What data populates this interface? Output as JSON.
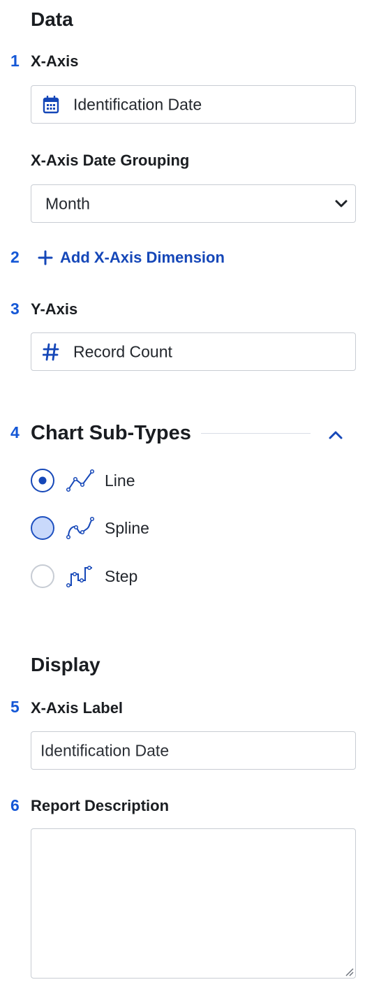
{
  "data_section": {
    "title": "Data",
    "x_axis": {
      "step": "1",
      "label": "X-Axis",
      "value": "Identification Date",
      "icon": "calendar-icon"
    },
    "date_grouping": {
      "label": "X-Axis Date Grouping",
      "value": "Month"
    },
    "add_dimension": {
      "step": "2",
      "label": "Add X-Axis Dimension"
    },
    "y_axis": {
      "step": "3",
      "label": "Y-Axis",
      "value": "Record Count",
      "icon": "hash-icon"
    }
  },
  "chart_subtypes": {
    "step": "4",
    "title": "Chart Sub-Types",
    "selected": "Line",
    "options": [
      {
        "label": "Line",
        "state": "selected",
        "icon": "line-chart-icon"
      },
      {
        "label": "Spline",
        "state": "hovered",
        "icon": "spline-chart-icon"
      },
      {
        "label": "Step",
        "state": "unselected",
        "icon": "step-chart-icon"
      }
    ]
  },
  "display_section": {
    "title": "Display",
    "x_axis_label": {
      "step": "5",
      "label": "X-Axis Label",
      "value": "Identification Date"
    },
    "report_description": {
      "step": "6",
      "label": "Report Description",
      "value": ""
    }
  },
  "colors": {
    "accent": "#1547b8",
    "step_number": "#1457d6",
    "border": "#c8ccd3",
    "text": "#1a1d21",
    "hover_fill": "#c9d9fb"
  }
}
